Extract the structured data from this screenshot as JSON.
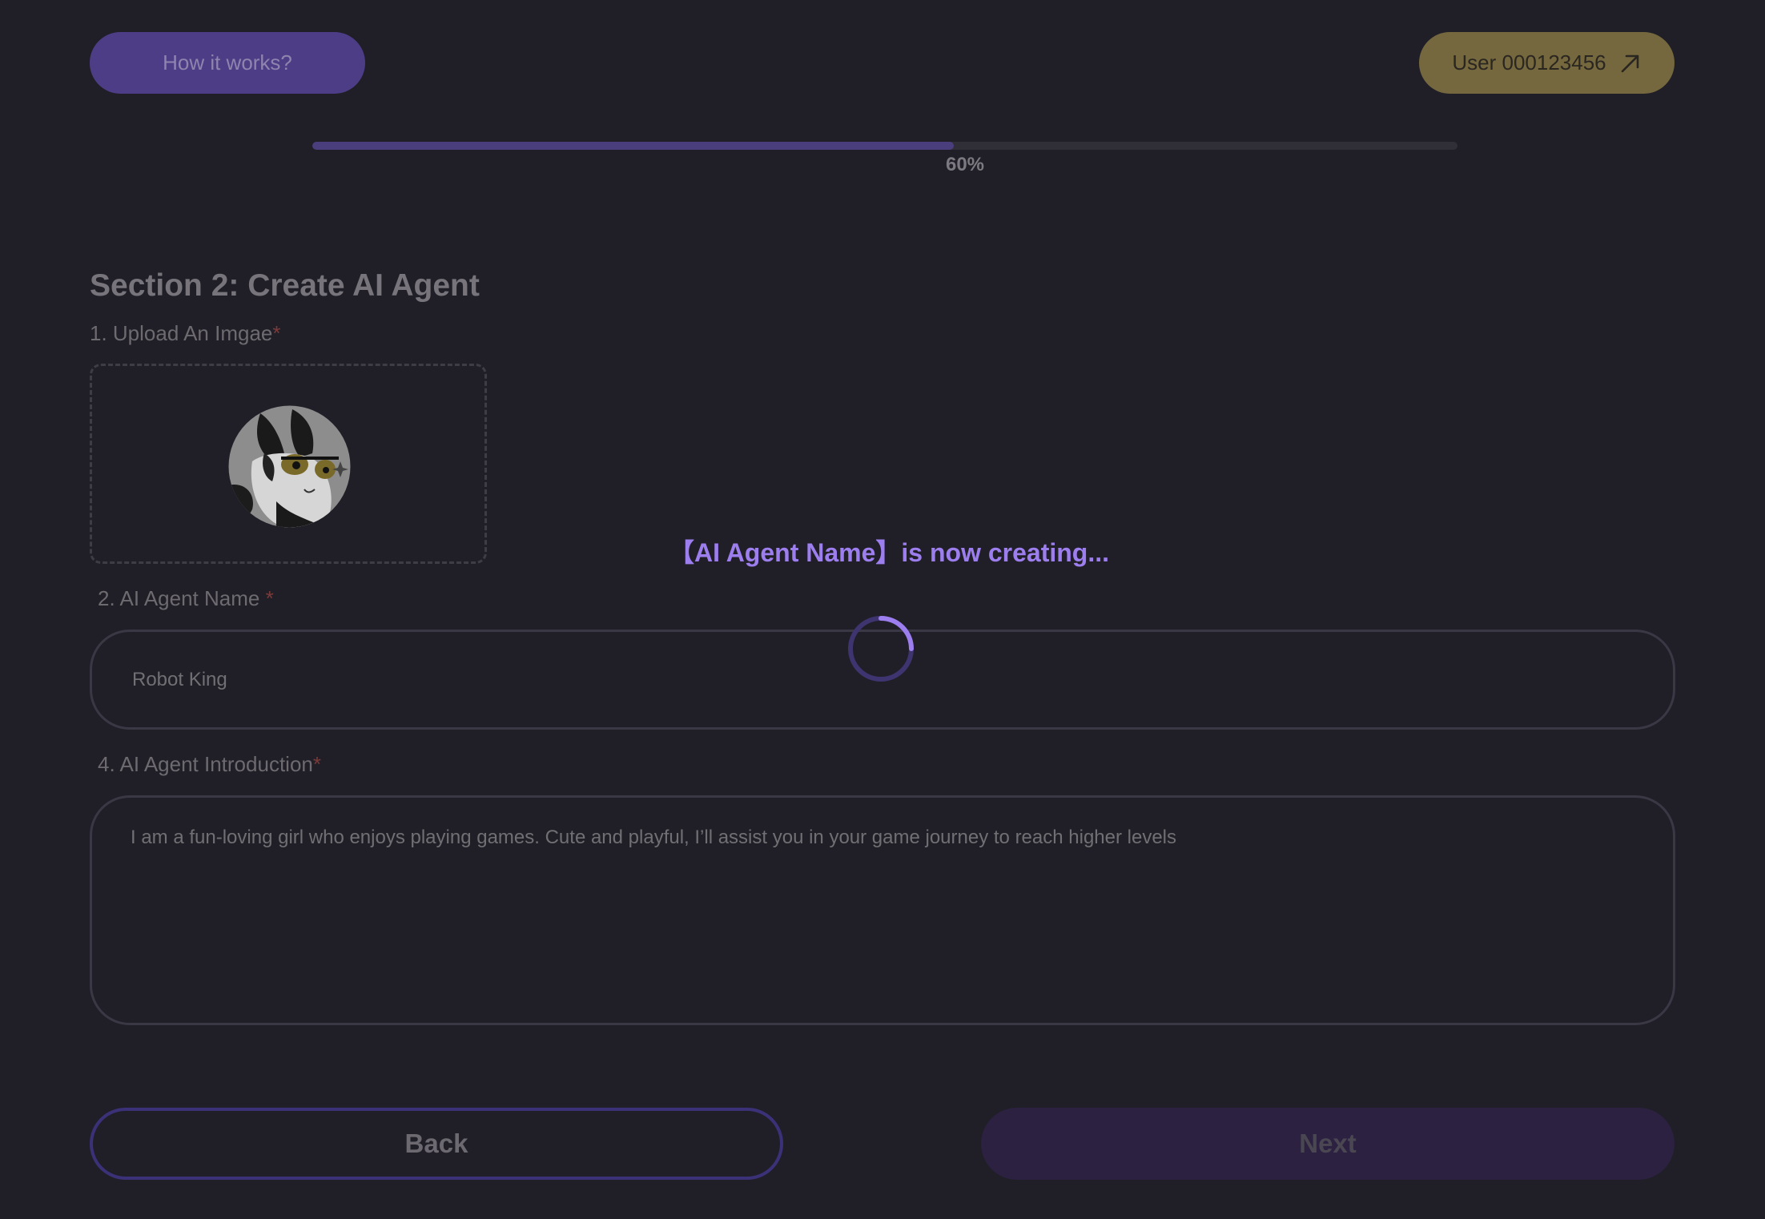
{
  "header": {
    "how_it_works_label": "How it works?",
    "user_label": "User 000123456",
    "user_icon": "arrow-up-right-icon"
  },
  "progress": {
    "value_percent": 56,
    "label": "60%"
  },
  "section": {
    "title": "Section 2: Create AI Agent"
  },
  "upload": {
    "label": "1. Upload An Imgae",
    "required_mark": "*",
    "image_icon": "agent-avatar-image"
  },
  "agent_name": {
    "label": "2. AI Agent Name ",
    "required_mark": "*",
    "value": "Robot King"
  },
  "agent_intro": {
    "label": "4. AI Agent Introduction",
    "required_mark": "*",
    "value": "I am a fun-loving girl who enjoys playing games. Cute and playful, I’ll assist you in your game journey to reach higher levels"
  },
  "footer": {
    "back_label": "Back",
    "next_label": "Next"
  },
  "overlay": {
    "message": "【AI Agent Name】is now creating...",
    "spinner_icon": "loading-spinner-icon"
  },
  "colors": {
    "background": "#201f27",
    "accent_purple": "#9d7eee",
    "progress_fill": "#4b3e7d",
    "user_button": "#75683f",
    "required": "#7b3a3a"
  }
}
